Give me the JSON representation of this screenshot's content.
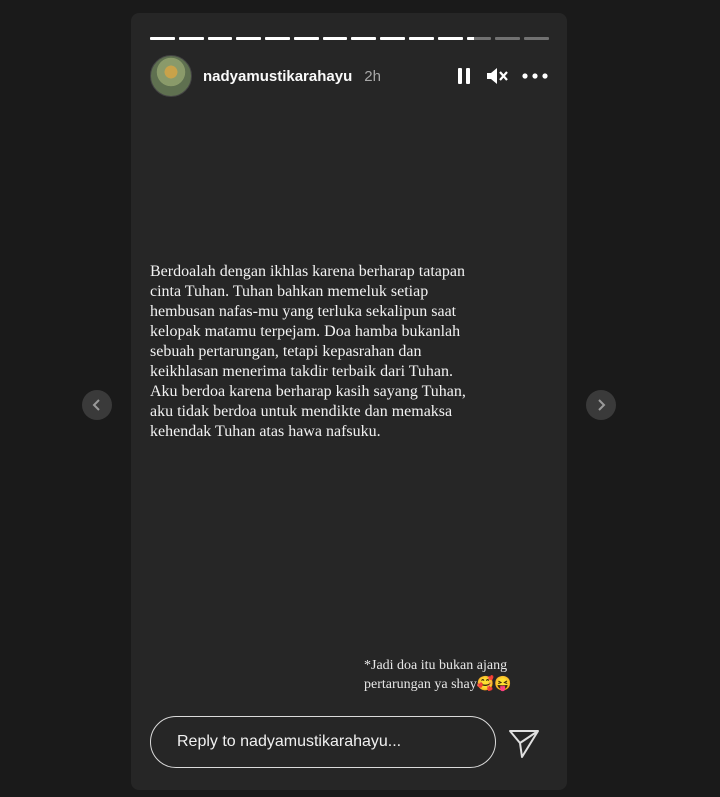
{
  "story": {
    "username": "nadyamustikarahayu",
    "time": "2h",
    "segments": [
      1,
      1,
      1,
      1,
      1,
      1,
      1,
      1,
      1,
      1,
      1,
      0.3,
      0,
      0
    ],
    "body": "Berdoalah dengan ikhlas karena berharap tatapan\ncinta Tuhan. Tuhan bahkan memeluk setiap\nhembusan nafas-mu yang terluka sekalipun saat\nkelopak matamu terpejam. Doa hamba  bukanlah\nsebuah pertarungan, tetapi kepasrahan dan\nkeikhlasan menerima takdir terbaik dari Tuhan.\nAku berdoa karena berharap kasih sayang Tuhan,\naku tidak berdoa untuk mendikte dan memaksa\nkehendak Tuhan atas hawa nafsuku.",
    "footnote": "*Jadi doa itu bukan ajang\npertarungan ya shay🥰😝"
  },
  "reply": {
    "placeholder": "Reply to nadyamustikarahayu..."
  },
  "icons": {
    "pause": "pause-icon",
    "mute": "speaker-muted-icon",
    "more": "more-icon",
    "send": "send-icon",
    "prev": "chevron-left-icon",
    "next": "chevron-right-icon"
  }
}
